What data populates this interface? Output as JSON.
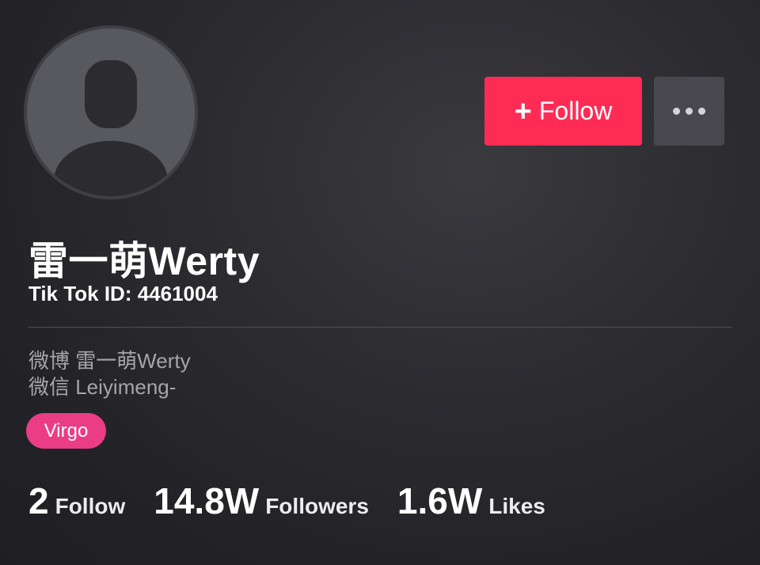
{
  "profile": {
    "display_name": "雷一萌Werty",
    "tiktok_id": "Tik Tok ID: 4461004",
    "avatar_icon": "default-avatar-icon"
  },
  "actions": {
    "follow_plus": "+",
    "follow_label": "Follow",
    "follow_color": "#fe2c55",
    "more_icon": "more-dots-icon"
  },
  "bio": {
    "lines": [
      "微博 雷一萌Werty",
      "微信 Leiyimeng-"
    ]
  },
  "tag": {
    "label": "Virgo",
    "color": "#ea3d86"
  },
  "stats": [
    {
      "value": "2",
      "label": "Follow"
    },
    {
      "value": "14.8W",
      "label": "Followers"
    },
    {
      "value": "1.6W",
      "label": "Likes"
    }
  ]
}
